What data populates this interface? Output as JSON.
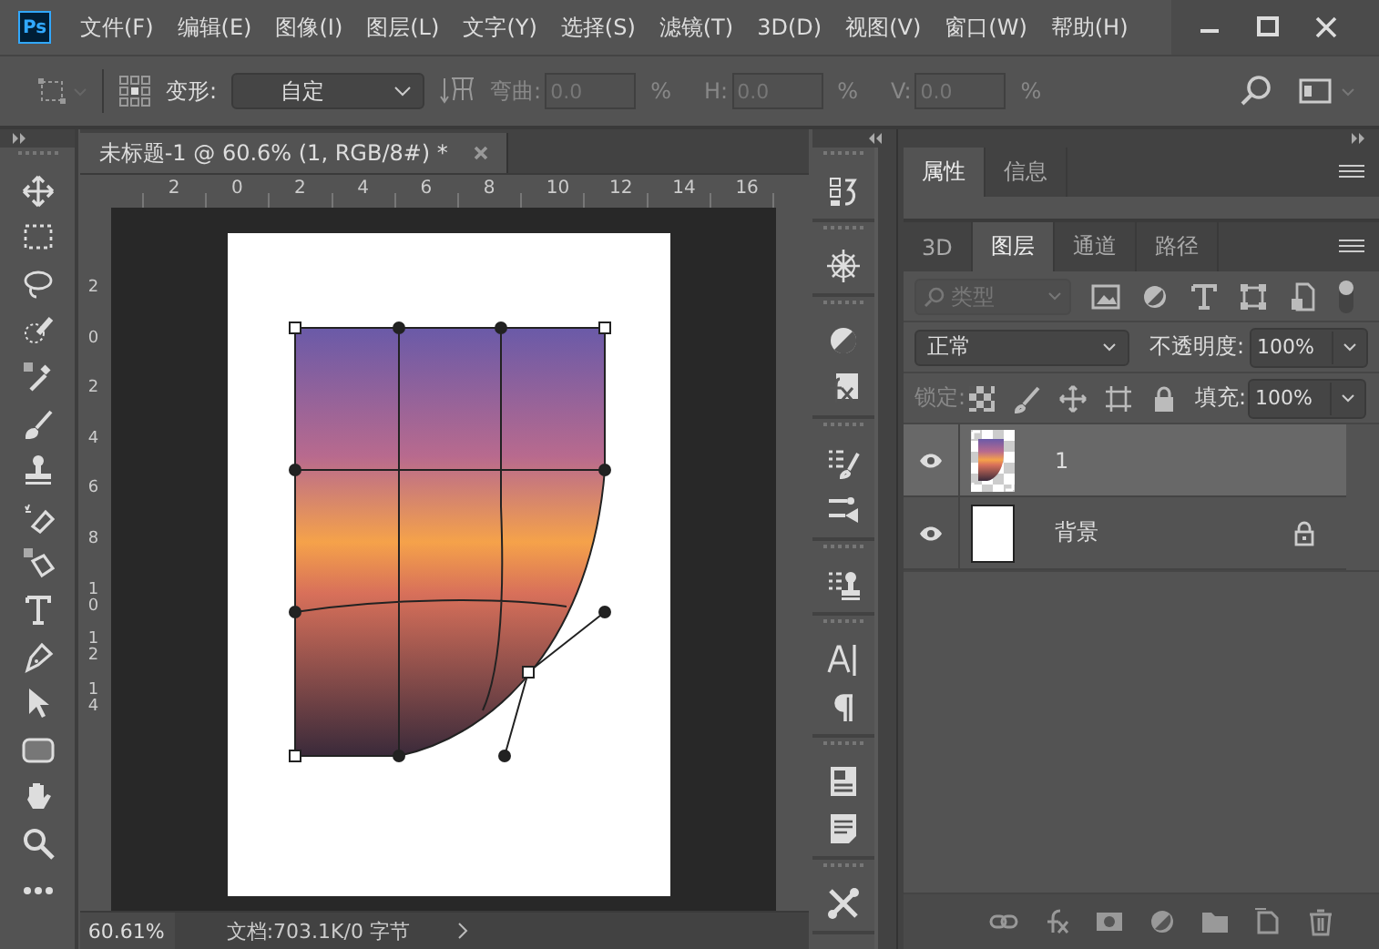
{
  "app_logo": "Ps",
  "menu": [
    "文件(F)",
    "编辑(E)",
    "图像(I)",
    "图层(L)",
    "文字(Y)",
    "选择(S)",
    "滤镜(T)",
    "3D(D)",
    "视图(V)",
    "窗口(W)",
    "帮助(H)"
  ],
  "options_bar": {
    "transform_label": "变形:",
    "transform_mode": "自定",
    "warp_disabled": true,
    "fields": [
      {
        "label": "弯曲:",
        "value": "0.0",
        "unit": "%"
      },
      {
        "label": "H:",
        "value": "0.0",
        "unit": "%"
      },
      {
        "label": "V:",
        "value": "0.0",
        "unit": "%"
      }
    ]
  },
  "document_tab": {
    "title": "未标题-1 @ 60.6% (1, RGB/8#) *",
    "selected": true
  },
  "ruler": {
    "top_labels": [
      "2",
      "0",
      "2",
      "4",
      "6",
      "8",
      "10",
      "12",
      "14",
      "16"
    ],
    "left_labels": [
      "2",
      "0",
      "2",
      "4",
      "6",
      "8",
      "10",
      "12",
      "14"
    ]
  },
  "status_bar": {
    "zoom": "60.61%",
    "doc_info": "文档:703.1K/0 字节"
  },
  "panel_tabs": [
    {
      "label": "属性",
      "selected": true
    },
    {
      "label": "信息",
      "selected": false
    }
  ],
  "layer_tabs": [
    {
      "label": "3D",
      "selected": false
    },
    {
      "label": "图层",
      "selected": true
    },
    {
      "label": "通道",
      "selected": false
    },
    {
      "label": "路径",
      "selected": false
    }
  ],
  "layers_panel": {
    "filter_placeholder": "类型",
    "blend_mode": "正常",
    "opacity_label": "不透明度:",
    "opacity": "100%",
    "lock_label": "锁定:",
    "fill_label": "填充:",
    "fill": "100%",
    "layers": [
      {
        "name": "1",
        "kind": "image",
        "selected": true,
        "visible": true,
        "locked": false
      },
      {
        "name": "背景",
        "kind": "background",
        "selected": false,
        "visible": true,
        "locked": true
      }
    ]
  }
}
